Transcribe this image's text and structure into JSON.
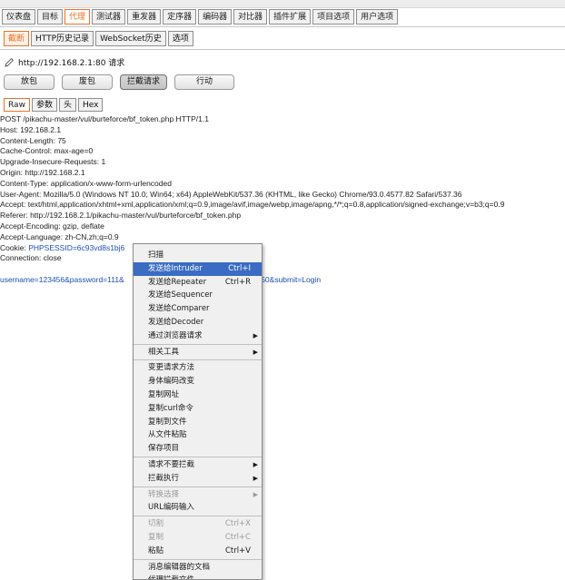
{
  "main_tabs": [
    {
      "label": "仪表盘",
      "active": false
    },
    {
      "label": "目标",
      "active": false
    },
    {
      "label": "代理",
      "active": true
    },
    {
      "label": "测试器",
      "active": false
    },
    {
      "label": "重发器",
      "active": false
    },
    {
      "label": "定序器",
      "active": false
    },
    {
      "label": "编码器",
      "active": false
    },
    {
      "label": "对比器",
      "active": false
    },
    {
      "label": "插件扩展",
      "active": false
    },
    {
      "label": "项目选项",
      "active": false
    },
    {
      "label": "用户选项",
      "active": false
    }
  ],
  "sub_tabs": [
    {
      "label": "截断",
      "active": true
    },
    {
      "label": "HTTP历史记录",
      "active": false
    },
    {
      "label": "WebSocket历史",
      "active": false
    },
    {
      "label": "选项",
      "active": false
    }
  ],
  "intercept": {
    "url_text": "http://192.168.2.1:80 请求"
  },
  "actions": {
    "forward": "放包",
    "drop": "废包",
    "intercept_toggle": "拦截请求",
    "action": "行动"
  },
  "view_tabs": [
    "Raw",
    "参数",
    "头",
    "Hex"
  ],
  "request": {
    "lines": [
      "POST /pikachu-master/vul/burteforce/bf_token.php HTTP/1.1",
      "Host: 192.168.2.1",
      "Content-Length: 75",
      "Cache-Control: max-age=0",
      "Upgrade-Insecure-Requests: 1",
      "Origin: http://192.168.2.1",
      "Content-Type: application/x-www-form-urlencoded",
      "User-Agent: Mozilla/5.0 (Windows NT 10.0; Win64; x64) AppleWebKit/537.36 (KHTML, like Gecko) Chrome/93.0.4577.82 Safari/537.36",
      "Accept: text/html,application/xhtml+xml,application/xml;q=0.9,image/avif,image/webp,image/apng,*/*;q=0.8,application/signed-exchange;v=b3;q=0.9",
      "Referer: http://192.168.2.1/pikachu-master/vul/burteforce/bf_token.php",
      "Accept-Encoding: gzip, deflate",
      "Accept-Language: zh-CN,zh;q=0.9"
    ],
    "cookie_label": "Cookie: ",
    "cookie_value": "PHPSESSID=6c93vd8s1bj6",
    "connection": "Connection: close",
    "body_start": "username=123456&password=111&",
    "body_end": "8150&submit=Login"
  },
  "context_menu": {
    "items": [
      {
        "label": "扫描"
      },
      {
        "label": "发送给Intruder",
        "shortcut": "Ctrl+I",
        "highlight": true
      },
      {
        "label": "发送给Repeater",
        "shortcut": "Ctrl+R"
      },
      {
        "label": "发送给Sequencer"
      },
      {
        "label": "发送给Comparer"
      },
      {
        "label": "发送给Decoder"
      },
      {
        "label": "通过浏览器请求",
        "submenu": true
      },
      {
        "separator": true
      },
      {
        "label": "相关工具",
        "submenu": true
      },
      {
        "separator": true
      },
      {
        "label": "变更请求方法"
      },
      {
        "label": "身体编码改变"
      },
      {
        "label": "复制网址"
      },
      {
        "label": "复制curl命令"
      },
      {
        "label": "复制到文件"
      },
      {
        "label": "从文件粘贴"
      },
      {
        "label": "保存项目"
      },
      {
        "separator": true
      },
      {
        "label": "请求不要拦截",
        "submenu": true
      },
      {
        "label": "拦截执行",
        "submenu": true
      },
      {
        "separator": true
      },
      {
        "label": "转换选择",
        "submenu": true,
        "disabled": true
      },
      {
        "label": "URL编码输入"
      },
      {
        "separator": true
      },
      {
        "label": "切割",
        "shortcut": "Ctrl+X",
        "disabled": true
      },
      {
        "label": "复制",
        "shortcut": "Ctrl+C",
        "disabled": true
      },
      {
        "label": "粘贴",
        "shortcut": "Ctrl+V"
      },
      {
        "separator": true
      },
      {
        "label": "消息编辑器的文档"
      },
      {
        "label": "代理拦截文件"
      }
    ]
  }
}
